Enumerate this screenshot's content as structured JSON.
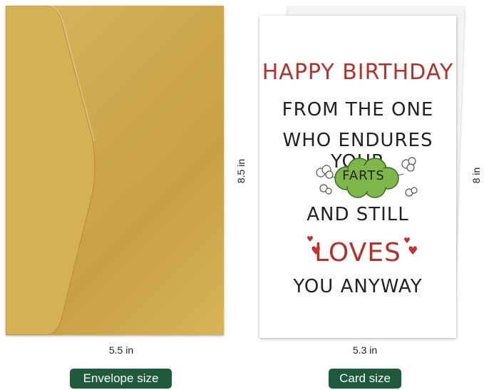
{
  "card": {
    "line1": "HAPPY BIRTHDAY",
    "line2": "FROM THE ONE",
    "line3": "WHO ENDURES YOUR",
    "cloud_word": "FARTS",
    "line4": "AND STILL",
    "line5": "LOVES",
    "line6": "YOU ANYWAY"
  },
  "dimensions": {
    "envelope_height": "8.5 in",
    "envelope_width": "5.5 in",
    "card_height": "8 in",
    "card_width": "5.3 in"
  },
  "labels": {
    "envelope": "Envelope size",
    "card": "Card size"
  },
  "colors": {
    "envelope_gold": "#cfa94f",
    "text_red": "#b5312c",
    "cloud_green": "#7fb64a",
    "pill_green": "#1e5a3c"
  }
}
